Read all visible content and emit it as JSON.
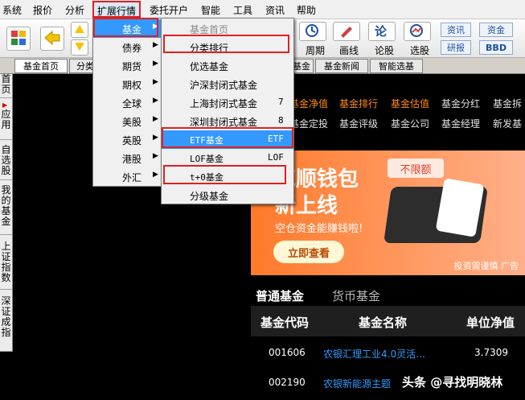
{
  "menubar": [
    "系统",
    "报价",
    "分析",
    "扩展行情",
    "委托开户",
    "智能",
    "工具",
    "资讯",
    "帮助"
  ],
  "toolbar": {
    "labels": [
      "周期",
      "画线",
      "论股",
      "选股"
    ],
    "small_buttons": [
      "资讯",
      "资金",
      "研报",
      "BBD"
    ]
  },
  "tabs": [
    "基金首页",
    "分类",
    "基金",
    "基金新闻",
    "智能选基"
  ],
  "side_tabs": [
    "首页",
    "应用",
    "自选股",
    "我的基金",
    "上证指数",
    "深证成指"
  ],
  "menu1": [
    {
      "label": "基金"
    },
    {
      "label": "债券"
    },
    {
      "label": "期货"
    },
    {
      "label": "期权"
    },
    {
      "label": "全球"
    },
    {
      "label": "美股"
    },
    {
      "label": "英股"
    },
    {
      "label": "港股"
    },
    {
      "label": "外汇"
    }
  ],
  "menu2": [
    {
      "label": "基金首页",
      "shortcut": ""
    },
    {
      "label": "分类排行",
      "shortcut": ""
    },
    {
      "label": "优选基金",
      "shortcut": ""
    },
    {
      "label": "沪深封闭式基金",
      "shortcut": ""
    },
    {
      "label": "上海封闭式基金",
      "shortcut": "7"
    },
    {
      "label": "深圳封闭式基金",
      "shortcut": "8"
    },
    {
      "label": "ETF基金",
      "shortcut": "ETF"
    },
    {
      "label": "LOF基金",
      "shortcut": "LOF"
    },
    {
      "label": "t+0基金",
      "shortcut": ""
    },
    {
      "label": "分级基金",
      "shortcut": ""
    }
  ],
  "content": {
    "nav_row1": [
      "基金净值",
      "基金排行",
      "基金估值",
      "基金分红",
      "基金拆"
    ],
    "nav_row2": [
      "基金定投",
      "基金评级",
      "基金公司",
      "基金经理",
      "新发基"
    ],
    "banner": {
      "title1": "花顺钱包",
      "title2": "新上线",
      "subtitle": "空仓资金能赚钱啦!",
      "button": "立即查看",
      "badge": "不限额",
      "ad_note": "投资需谨慎 广告"
    },
    "fund_tabs": [
      "普通基金",
      "货币基金"
    ],
    "table_headers": [
      "基金代码",
      "基金名称",
      "单位净值"
    ],
    "rows": [
      {
        "code": "001606",
        "name": "农银汇理工业4.0灵活…",
        "nav": "3.7309"
      },
      {
        "code": "002190",
        "name": "农银新能源主题",
        "nav": ""
      }
    ]
  },
  "watermark": "头条 @寻找明晓林",
  "colors": {
    "accent_orange": "#ff8c1a",
    "fund_name_blue": "#2f9cff",
    "highlight_red": "#e02020",
    "menu_select": "#3399ff"
  }
}
